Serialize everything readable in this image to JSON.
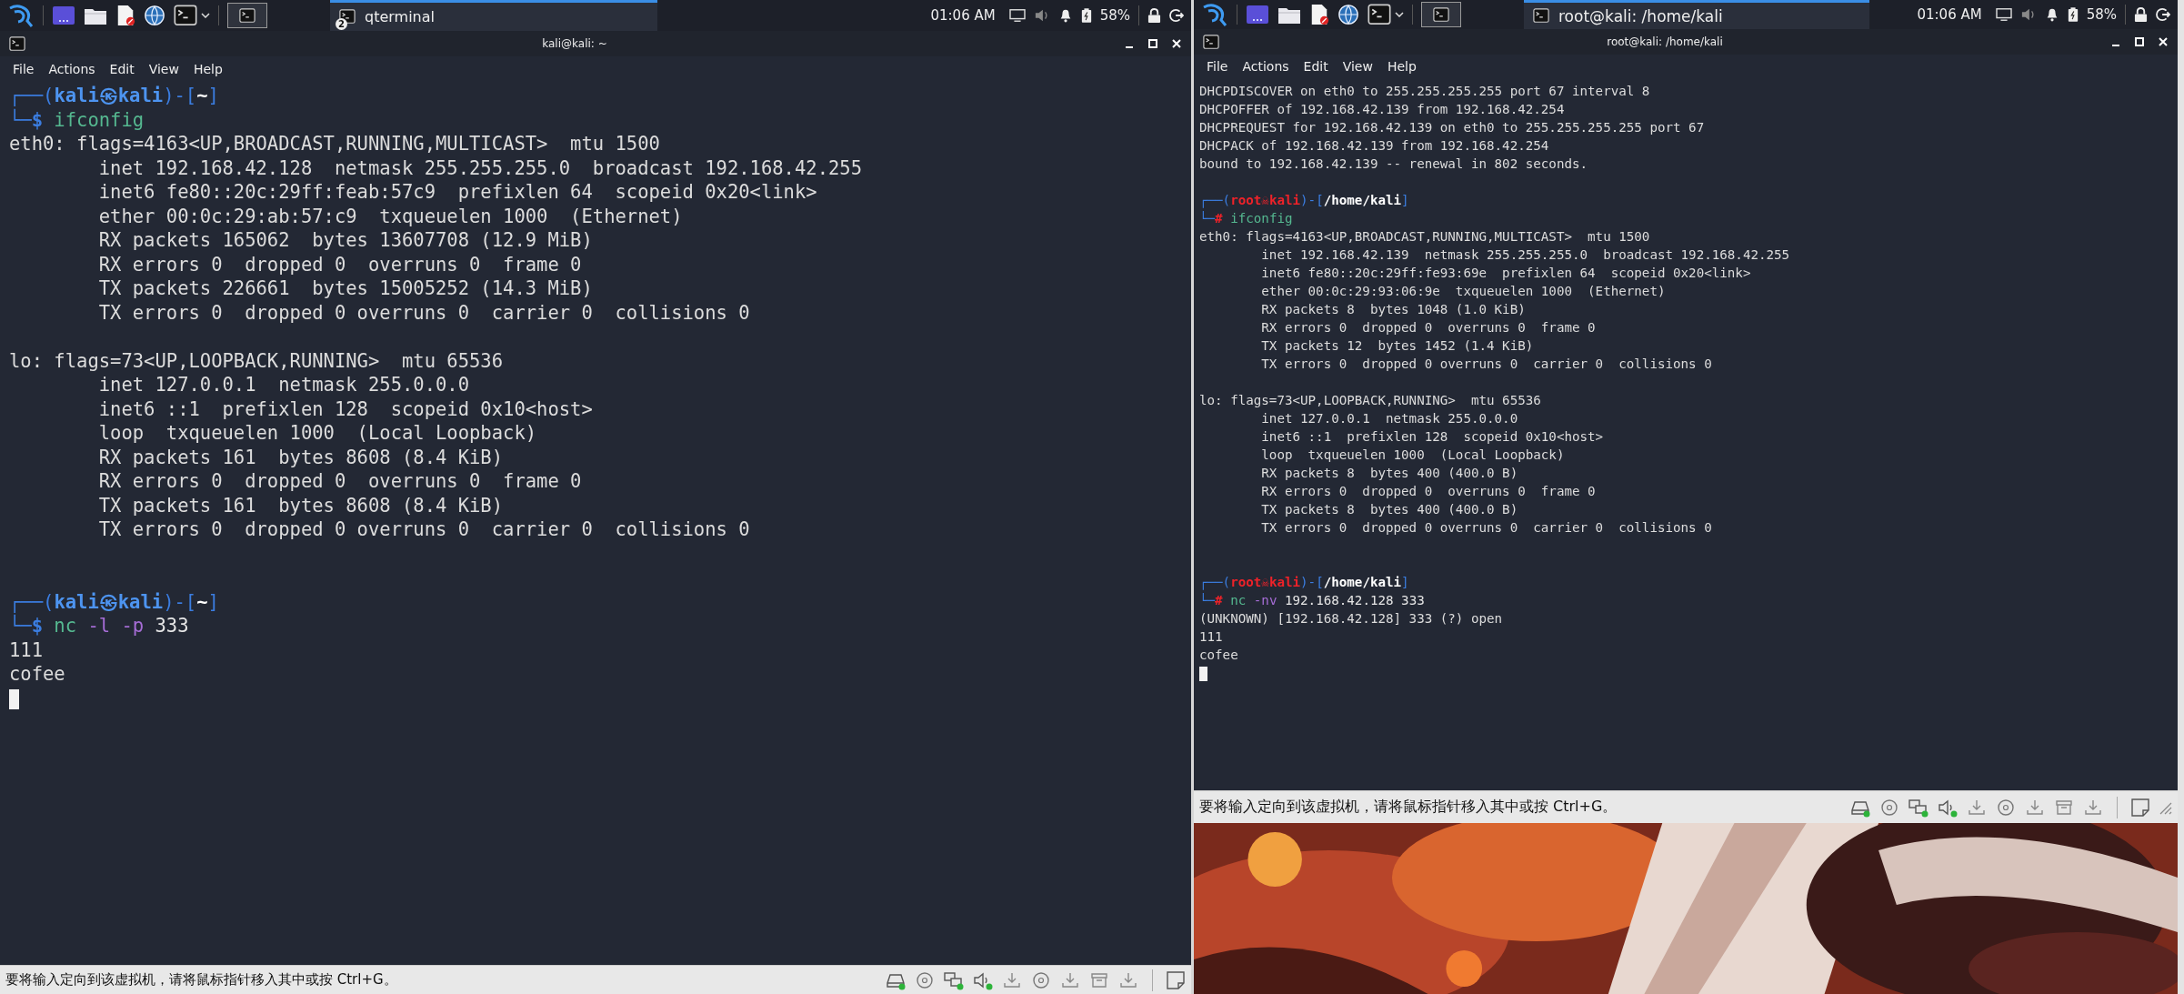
{
  "vms": [
    {
      "taskbar": {
        "task_badge": "2",
        "task_label": "qterminal",
        "clock": "01:06 AM",
        "battery": "58%"
      },
      "window_title": "kali@kali: ~",
      "menu": [
        "File",
        "Actions",
        "Edit",
        "View",
        "Help"
      ],
      "terminal": [
        {
          "kind": "prompt",
          "spans": [
            {
              "text": "┌──(",
              "kind": "frame"
            },
            {
              "text": "kali㉿kali",
              "kind": "user"
            },
            {
              "text": ")-[",
              "kind": "frame"
            },
            {
              "text": "~",
              "kind": "path"
            },
            {
              "text": "]",
              "kind": "frame"
            }
          ]
        },
        {
          "kind": "command",
          "spans": [
            {
              "text": "└─",
              "kind": "frame"
            },
            {
              "text": "$",
              "kind": "prompt_user"
            },
            {
              "text": " ifconfig",
              "kind": "command"
            }
          ]
        },
        {
          "kind": "output",
          "text": "eth0: flags=4163<UP,BROADCAST,RUNNING,MULTICAST>  mtu 1500"
        },
        {
          "kind": "output",
          "text": "        inet 192.168.42.128  netmask 255.255.255.0  broadcast 192.168.42.255"
        },
        {
          "kind": "output",
          "text": "        inet6 fe80::20c:29ff:feab:57c9  prefixlen 64  scopeid 0x20<link>"
        },
        {
          "kind": "output",
          "text": "        ether 00:0c:29:ab:57:c9  txqueuelen 1000  (Ethernet)"
        },
        {
          "kind": "output",
          "text": "        RX packets 165062  bytes 13607708 (12.9 MiB)"
        },
        {
          "kind": "output",
          "text": "        RX errors 0  dropped 0  overruns 0  frame 0"
        },
        {
          "kind": "output",
          "text": "        TX packets 226661  bytes 15005252 (14.3 MiB)"
        },
        {
          "kind": "output",
          "text": "        TX errors 0  dropped 0 overruns 0  carrier 0  collisions 0"
        },
        {
          "kind": "blank"
        },
        {
          "kind": "output",
          "text": "lo: flags=73<UP,LOOPBACK,RUNNING>  mtu 65536"
        },
        {
          "kind": "output",
          "text": "        inet 127.0.0.1  netmask 255.0.0.0"
        },
        {
          "kind": "output",
          "text": "        inet6 ::1  prefixlen 128  scopeid 0x10<host>"
        },
        {
          "kind": "output",
          "text": "        loop  txqueuelen 1000  (Local Loopback)"
        },
        {
          "kind": "output",
          "text": "        RX packets 161  bytes 8608 (8.4 KiB)"
        },
        {
          "kind": "output",
          "text": "        RX errors 0  dropped 0  overruns 0  frame 0"
        },
        {
          "kind": "output",
          "text": "        TX packets 161  bytes 8608 (8.4 KiB)"
        },
        {
          "kind": "output",
          "text": "        TX errors 0  dropped 0 overruns 0  carrier 0  collisions 0"
        },
        {
          "kind": "blank"
        },
        {
          "kind": "blank"
        },
        {
          "kind": "prompt",
          "spans": [
            {
              "text": "┌──(",
              "kind": "frame"
            },
            {
              "text": "kali㉿kali",
              "kind": "user"
            },
            {
              "text": ")-[",
              "kind": "frame"
            },
            {
              "text": "~",
              "kind": "path"
            },
            {
              "text": "]",
              "kind": "frame"
            }
          ]
        },
        {
          "kind": "command",
          "spans": [
            {
              "text": "└─",
              "kind": "frame"
            },
            {
              "text": "$",
              "kind": "prompt_user"
            },
            {
              "text": " nc",
              "kind": "command"
            },
            {
              "text": " -l -p",
              "kind": "option"
            },
            {
              "text": " 333",
              "kind": "argument"
            }
          ]
        },
        {
          "kind": "output",
          "text": "111"
        },
        {
          "kind": "output",
          "text": "cofee"
        },
        {
          "kind": "cursor"
        }
      ],
      "status_bar": {
        "message": "要将输入定向到该虚拟机，请将鼠标指针移入其中或按 Ctrl+G。",
        "devices": [
          {
            "kind": "hdd",
            "connected": true
          },
          {
            "kind": "optical",
            "connected": false
          },
          {
            "kind": "network",
            "connected": true
          },
          {
            "kind": "sound",
            "connected": true
          },
          {
            "kind": "usb",
            "connected": false
          },
          {
            "kind": "optical",
            "connected": false
          },
          {
            "kind": "usb",
            "connected": false
          },
          {
            "kind": "storage",
            "connected": false
          },
          {
            "kind": "usb",
            "connected": false
          }
        ]
      }
    },
    {
      "taskbar": {
        "task_label": "root@kali: /home/kali",
        "clock": "01:06 AM",
        "battery": "58%"
      },
      "window_title": "root@kali: /home/kali",
      "menu": [
        "File",
        "Actions",
        "Edit",
        "View",
        "Help"
      ],
      "terminal": [
        {
          "kind": "output",
          "text": "DHCPDISCOVER on eth0 to 255.255.255.255 port 67 interval 8"
        },
        {
          "kind": "output",
          "text": "DHCPOFFER of 192.168.42.139 from 192.168.42.254"
        },
        {
          "kind": "output",
          "text": "DHCPREQUEST for 192.168.42.139 on eth0 to 255.255.255.255 port 67"
        },
        {
          "kind": "output",
          "text": "DHCPACK of 192.168.42.139 from 192.168.42.254"
        },
        {
          "kind": "output",
          "text": "bound to 192.168.42.139 -- renewal in 802 seconds."
        },
        {
          "kind": "blank"
        },
        {
          "kind": "prompt",
          "spans": [
            {
              "text": "┌──(",
              "kind": "frame"
            },
            {
              "text": "root☠kali",
              "kind": "root"
            },
            {
              "text": ")-[",
              "kind": "frame"
            },
            {
              "text": "/home/kali",
              "kind": "path"
            },
            {
              "text": "]",
              "kind": "frame"
            }
          ]
        },
        {
          "kind": "command",
          "spans": [
            {
              "text": "└─",
              "kind": "frame"
            },
            {
              "text": "#",
              "kind": "prompt_root"
            },
            {
              "text": " ifconfig",
              "kind": "command"
            }
          ]
        },
        {
          "kind": "output",
          "text": "eth0: flags=4163<UP,BROADCAST,RUNNING,MULTICAST>  mtu 1500"
        },
        {
          "kind": "output",
          "text": "        inet 192.168.42.139  netmask 255.255.255.0  broadcast 192.168.42.255"
        },
        {
          "kind": "output",
          "text": "        inet6 fe80::20c:29ff:fe93:69e  prefixlen 64  scopeid 0x20<link>"
        },
        {
          "kind": "output",
          "text": "        ether 00:0c:29:93:06:9e  txqueuelen 1000  (Ethernet)"
        },
        {
          "kind": "output",
          "text": "        RX packets 8  bytes 1048 (1.0 KiB)"
        },
        {
          "kind": "output",
          "text": "        RX errors 0  dropped 0  overruns 0  frame 0"
        },
        {
          "kind": "output",
          "text": "        TX packets 12  bytes 1452 (1.4 KiB)"
        },
        {
          "kind": "output",
          "text": "        TX errors 0  dropped 0 overruns 0  carrier 0  collisions 0"
        },
        {
          "kind": "blank"
        },
        {
          "kind": "output",
          "text": "lo: flags=73<UP,LOOPBACK,RUNNING>  mtu 65536"
        },
        {
          "kind": "output",
          "text": "        inet 127.0.0.1  netmask 255.0.0.0"
        },
        {
          "kind": "output",
          "text": "        inet6 ::1  prefixlen 128  scopeid 0x10<host>"
        },
        {
          "kind": "output",
          "text": "        loop  txqueuelen 1000  (Local Loopback)"
        },
        {
          "kind": "output",
          "text": "        RX packets 8  bytes 400 (400.0 B)"
        },
        {
          "kind": "output",
          "text": "        RX errors 0  dropped 0  overruns 0  frame 0"
        },
        {
          "kind": "output",
          "text": "        TX packets 8  bytes 400 (400.0 B)"
        },
        {
          "kind": "output",
          "text": "        TX errors 0  dropped 0 overruns 0  carrier 0  collisions 0"
        },
        {
          "kind": "blank"
        },
        {
          "kind": "blank"
        },
        {
          "kind": "prompt",
          "spans": [
            {
              "text": "┌──(",
              "kind": "frame"
            },
            {
              "text": "root☠kali",
              "kind": "root"
            },
            {
              "text": ")-[",
              "kind": "frame"
            },
            {
              "text": "/home/kali",
              "kind": "path"
            },
            {
              "text": "]",
              "kind": "frame"
            }
          ]
        },
        {
          "kind": "command",
          "spans": [
            {
              "text": "└─",
              "kind": "frame"
            },
            {
              "text": "#",
              "kind": "prompt_root"
            },
            {
              "text": " nc",
              "kind": "command"
            },
            {
              "text": " -nv",
              "kind": "option"
            },
            {
              "text": " 192.168.42.128 333",
              "kind": "argument"
            }
          ]
        },
        {
          "kind": "output",
          "text": "(UNKNOWN) [192.168.42.128] 333 (?) open"
        },
        {
          "kind": "output",
          "text": "111"
        },
        {
          "kind": "output",
          "text": "cofee"
        },
        {
          "kind": "cursor"
        }
      ],
      "status_bar": {
        "message": "要将输入定向到该虚拟机，请将鼠标指针移入其中或按 Ctrl+G。",
        "devices": [
          {
            "kind": "hdd",
            "connected": true
          },
          {
            "kind": "optical",
            "connected": false
          },
          {
            "kind": "network",
            "connected": true
          },
          {
            "kind": "sound",
            "connected": true
          },
          {
            "kind": "usb",
            "connected": false
          },
          {
            "kind": "optical",
            "connected": false
          },
          {
            "kind": "usb",
            "connected": false
          },
          {
            "kind": "storage",
            "connected": false
          },
          {
            "kind": "usb",
            "connected": false
          }
        ]
      }
    }
  ]
}
